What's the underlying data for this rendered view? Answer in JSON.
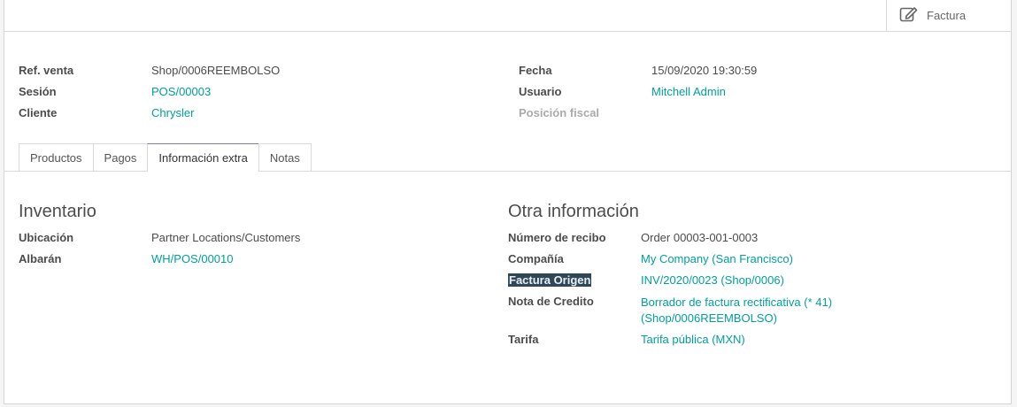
{
  "smart_button": {
    "label": "Factura",
    "icon": "edit-icon"
  },
  "header_fields": {
    "left": [
      {
        "label": "Ref. venta",
        "value": "Shop/0006REEMBOLSO"
      },
      {
        "label": "Sesión",
        "value": "POS/00003"
      },
      {
        "label": "Cliente",
        "value": "Chrysler"
      }
    ],
    "right": [
      {
        "label": "Fecha",
        "value": "15/09/2020 19:30:59"
      },
      {
        "label": "Usuario",
        "value": "Mitchell Admin"
      },
      {
        "label": "Posición fiscal",
        "value": ""
      }
    ]
  },
  "tabs": [
    {
      "label": "Productos"
    },
    {
      "label": "Pagos"
    },
    {
      "label": "Información extra",
      "active": true
    },
    {
      "label": "Notas"
    }
  ],
  "inventario": {
    "title": "Inventario",
    "fields": [
      {
        "label": "Ubicación",
        "value": "Partner Locations/Customers"
      },
      {
        "label": "Albarán",
        "value": "WH/POS/00010"
      }
    ]
  },
  "otra_info": {
    "title": "Otra información",
    "fields": [
      {
        "label": "Número de recibo",
        "value": "Order 00003-001-0003"
      },
      {
        "label": "Compañía",
        "value": "My Company (San Francisco)"
      },
      {
        "label": "Factura Origen",
        "value": "INV/2020/0023 (Shop/0006)"
      },
      {
        "label": "Nota de Credito",
        "value_line1": "Borrador de factura rectificativa (* 41)",
        "value_line2": "(Shop/0006REEMBOLSO)"
      },
      {
        "label": "Tarifa",
        "value": "Tarifa pública (MXN)"
      }
    ]
  },
  "colors": {
    "link": "#00a09d",
    "tab_active_border": "#7c7bad",
    "selection": "#2f4858"
  }
}
